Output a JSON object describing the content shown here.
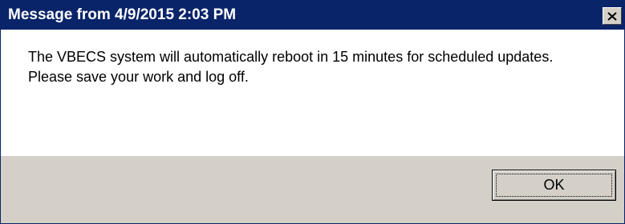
{
  "window": {
    "title": "Message from  4/9/2015 2:03 PM",
    "close_icon": "close-icon"
  },
  "message": {
    "text": "The VBECS system will automatically reboot in 15 minutes for scheduled updates. Please save your work and log off."
  },
  "buttons": {
    "ok_label": "OK"
  },
  "colors": {
    "titlebar": "#0a246a",
    "footer": "#d4d0c8",
    "body": "#ffffff"
  }
}
